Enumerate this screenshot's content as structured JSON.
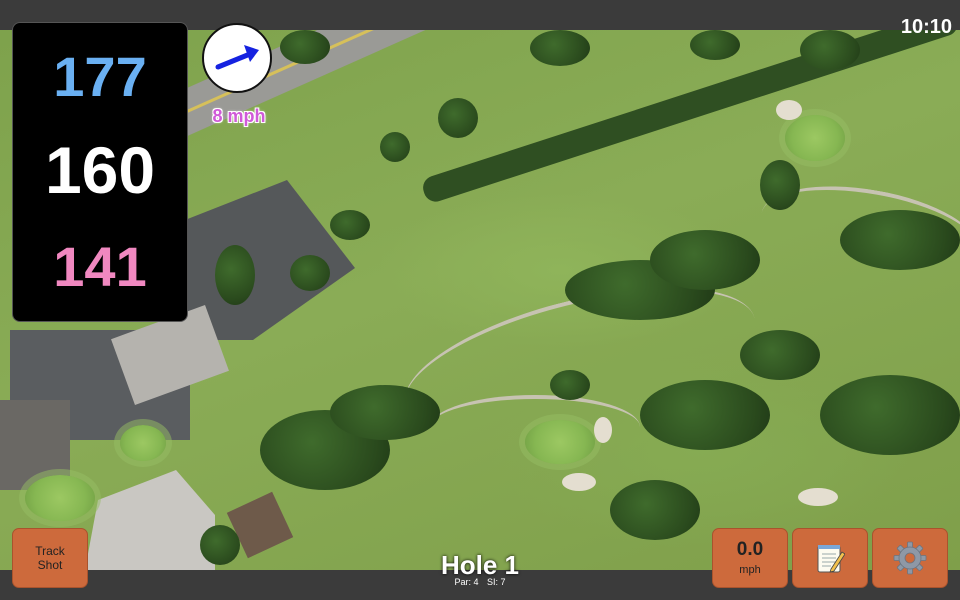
{
  "status": {
    "time": "10:10"
  },
  "distances": {
    "back": "177",
    "middle": "160",
    "front": "141"
  },
  "wind": {
    "speed_label": "8 mph",
    "direction_icon": "arrow-northeast-icon"
  },
  "controls": {
    "track_shot_line1": "Track",
    "track_shot_line2": "Shot",
    "speed_value": "0.0",
    "speed_unit": "mph",
    "notes_icon": "notepad-icon",
    "settings_icon": "gear-icon"
  },
  "hole": {
    "title": "Hole 1",
    "par_label": "Par: 4",
    "si_label": "SI: 7"
  },
  "colors": {
    "back_distance": "#6ab0f2",
    "middle_distance": "#ffffff",
    "front_distance": "#f088c0",
    "wind_text": "#d05ad8",
    "button": "#cd6a3c"
  }
}
